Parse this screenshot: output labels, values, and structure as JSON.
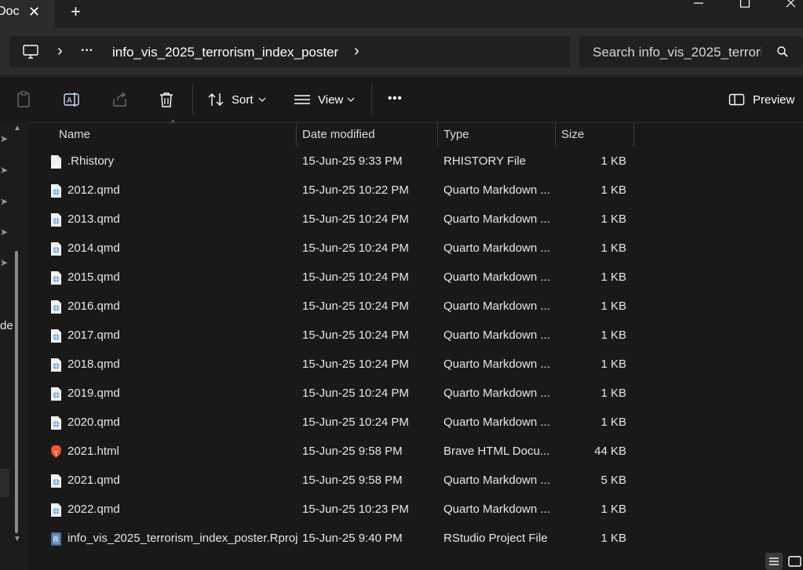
{
  "window": {
    "tab_title": "Doc",
    "tab_close": "✕",
    "new_tab": "+"
  },
  "nav": {
    "more": "···",
    "path_chevron": "›",
    "folder": "info_vis_2025_terrorism_index_poster",
    "folder_chevron": "›",
    "search_placeholder": "Search info_vis_2025_terrori"
  },
  "toolbar": {
    "sort_label": "Sort",
    "view_label": "View",
    "more_label": "•••",
    "preview_label": "Preview"
  },
  "sidebar": {
    "partial_label": "de"
  },
  "columns": {
    "name": "Name",
    "date": "Date modified",
    "type": "Type",
    "size": "Size"
  },
  "files": [
    {
      "name": ".Rhistory",
      "date": "15-Jun-25 9:33 PM",
      "type": "RHISTORY File",
      "size": "1 KB",
      "icon": "blank-file-icon"
    },
    {
      "name": "2012.qmd",
      "date": "15-Jun-25 10:22 PM",
      "type": "Quarto Markdown ...",
      "size": "1 KB",
      "icon": "quarto-file-icon"
    },
    {
      "name": "2013.qmd",
      "date": "15-Jun-25 10:24 PM",
      "type": "Quarto Markdown ...",
      "size": "1 KB",
      "icon": "quarto-file-icon"
    },
    {
      "name": "2014.qmd",
      "date": "15-Jun-25 10:24 PM",
      "type": "Quarto Markdown ...",
      "size": "1 KB",
      "icon": "quarto-file-icon"
    },
    {
      "name": "2015.qmd",
      "date": "15-Jun-25 10:24 PM",
      "type": "Quarto Markdown ...",
      "size": "1 KB",
      "icon": "quarto-file-icon"
    },
    {
      "name": "2016.qmd",
      "date": "15-Jun-25 10:24 PM",
      "type": "Quarto Markdown ...",
      "size": "1 KB",
      "icon": "quarto-file-icon"
    },
    {
      "name": "2017.qmd",
      "date": "15-Jun-25 10:24 PM",
      "type": "Quarto Markdown ...",
      "size": "1 KB",
      "icon": "quarto-file-icon"
    },
    {
      "name": "2018.qmd",
      "date": "15-Jun-25 10:24 PM",
      "type": "Quarto Markdown ...",
      "size": "1 KB",
      "icon": "quarto-file-icon"
    },
    {
      "name": "2019.qmd",
      "date": "15-Jun-25 10:24 PM",
      "type": "Quarto Markdown ...",
      "size": "1 KB",
      "icon": "quarto-file-icon"
    },
    {
      "name": "2020.qmd",
      "date": "15-Jun-25 10:24 PM",
      "type": "Quarto Markdown ...",
      "size": "1 KB",
      "icon": "quarto-file-icon"
    },
    {
      "name": "2021.html",
      "date": "15-Jun-25 9:58 PM",
      "type": "Brave HTML Docu...",
      "size": "44 KB",
      "icon": "brave-file-icon"
    },
    {
      "name": "2021.qmd",
      "date": "15-Jun-25 9:58 PM",
      "type": "Quarto Markdown ...",
      "size": "5 KB",
      "icon": "quarto-file-icon"
    },
    {
      "name": "2022.qmd",
      "date": "15-Jun-25 10:23 PM",
      "type": "Quarto Markdown ...",
      "size": "1 KB",
      "icon": "quarto-file-icon"
    },
    {
      "name": "info_vis_2025_terrorism_index_poster.Rproj",
      "date": "15-Jun-25 9:40 PM",
      "type": "RStudio Project File",
      "size": "1 KB",
      "icon": "rproj-file-icon"
    }
  ],
  "colors": {
    "window_bg": "#191919",
    "nav_bg": "#2b2b2b",
    "field_bg": "#202020",
    "quarto_blue": "#75aadb",
    "brave_orange": "#fb542b"
  }
}
